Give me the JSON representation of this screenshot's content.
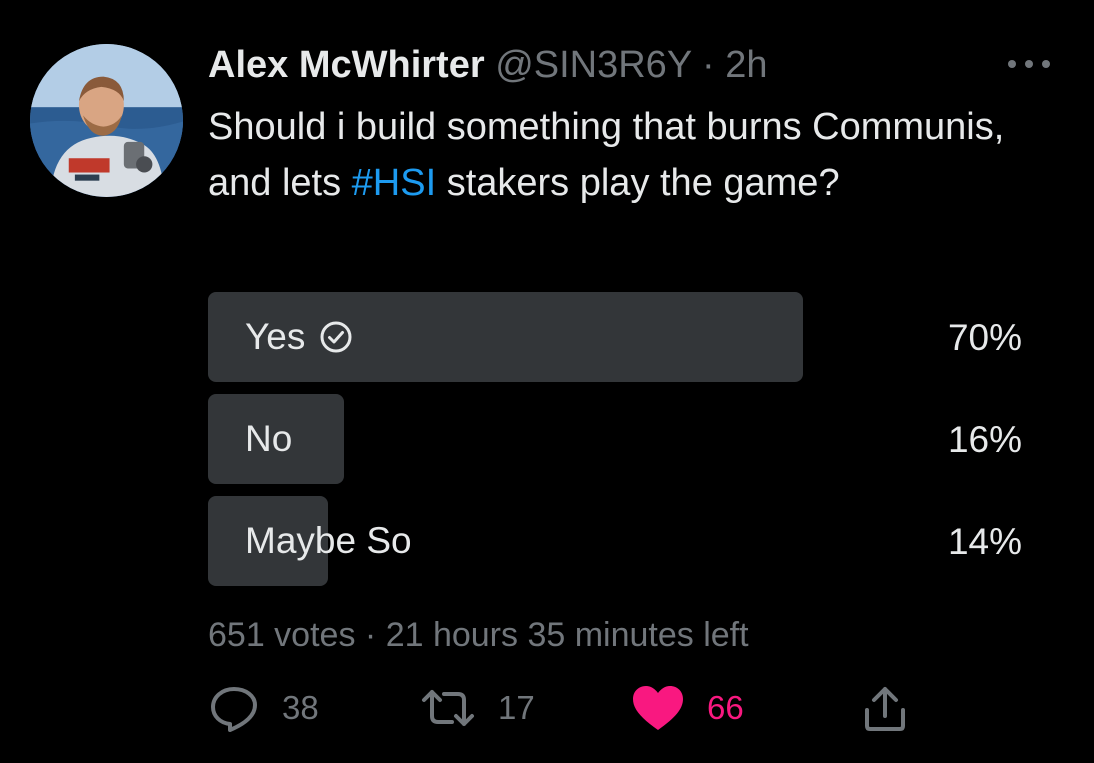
{
  "author": {
    "name": "Alex McWhirter",
    "handle": "@SIN3R6Y",
    "separator": "·",
    "time": "2h"
  },
  "tweet": {
    "text_before": "Should i build something that burns Communis, and lets ",
    "hashtag": "#HSI",
    "text_after": " stakers play the game?"
  },
  "poll": {
    "options": [
      {
        "label": "Yes",
        "percent_text": "70%",
        "percent": 70,
        "selected": true
      },
      {
        "label": "No",
        "percent_text": "16%",
        "percent": 16,
        "selected": false
      },
      {
        "label": "Maybe So",
        "percent_text": "14%",
        "percent": 14,
        "selected": false
      }
    ],
    "votes": "651 votes",
    "separator": "·",
    "time_left": "21 hours 35 minutes left"
  },
  "actions": {
    "replies": "38",
    "retweets": "17",
    "likes": "66"
  },
  "icons": {
    "more": "more-options-icon",
    "check": "checkmark-circle-icon",
    "reply": "reply-icon",
    "retweet": "retweet-icon",
    "like": "heart-icon",
    "share": "share-icon"
  },
  "colors": {
    "background": "#000000",
    "text": "#e7e9ea",
    "muted": "#71767b",
    "hashtag": "#1d9bf0",
    "like": "#f91880",
    "poll_bar": "#333639"
  }
}
